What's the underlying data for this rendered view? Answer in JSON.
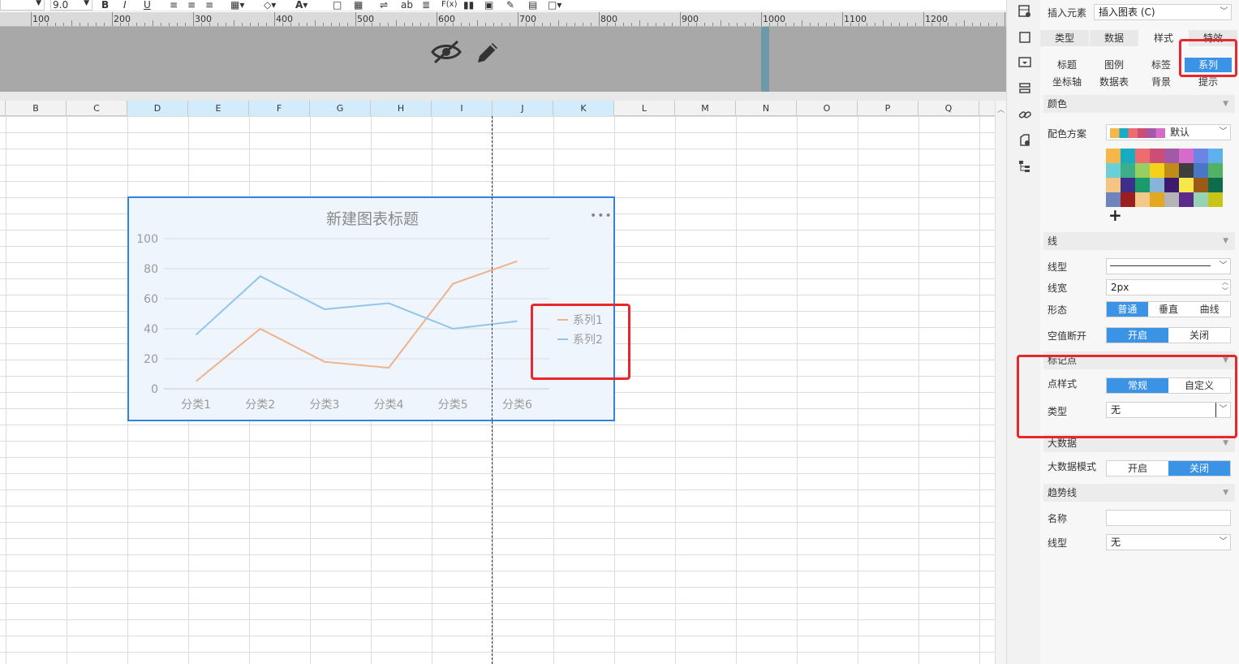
{
  "toolbar": {
    "font_size": "9.0",
    "bold": "B",
    "italic": "I",
    "underline": "U",
    "text_abc": "ab",
    "fx": "F(x)"
  },
  "ruler": {
    "labels": [
      "100",
      "200",
      "300",
      "400",
      "500",
      "600",
      "700",
      "800",
      "900",
      "1000",
      "1100",
      "1200"
    ]
  },
  "columns": [
    "B",
    "C",
    "D",
    "E",
    "F",
    "G",
    "H",
    "I",
    "J",
    "K",
    "L",
    "M",
    "N",
    "O",
    "P",
    "Q"
  ],
  "selected_columns": [
    "D",
    "E",
    "F",
    "G",
    "H",
    "I",
    "J",
    "K"
  ],
  "chart_data": {
    "type": "line",
    "title": "新建图表标题",
    "categories": [
      "分类1",
      "分类2",
      "分类3",
      "分类4",
      "分类5",
      "分类6"
    ],
    "series": [
      {
        "name": "系列1",
        "color": "#f0b28c",
        "values": [
          5,
          40,
          18,
          14,
          70,
          85
        ]
      },
      {
        "name": "系列2",
        "color": "#91c5ec",
        "values": [
          36,
          75,
          53,
          57,
          40,
          45
        ]
      }
    ],
    "ylim": [
      0,
      100
    ],
    "yticks": [
      "0",
      "20",
      "40",
      "60",
      "80",
      "100"
    ],
    "grid": true,
    "legend": "right",
    "menu": "•••"
  },
  "panel": {
    "insert_label": "插入元素",
    "insert_value": "插入图表 (C)",
    "tabs": [
      {
        "label": "类型",
        "active": false
      },
      {
        "label": "数据",
        "active": false
      },
      {
        "label": "样式",
        "active": true
      },
      {
        "label": "特效",
        "active": false
      }
    ],
    "subtabs_row1": [
      {
        "label": "标题",
        "active": false
      },
      {
        "label": "图例",
        "active": false
      },
      {
        "label": "标签",
        "active": false
      },
      {
        "label": "系列",
        "active": true
      }
    ],
    "subtabs_row2": [
      "坐标轴",
      "数据表",
      "背景",
      "提示"
    ],
    "color_section": "颜色",
    "scheme_label": "配色方案",
    "scheme_value": "默认",
    "palette": [
      "#f5b74a",
      "#1aabc4",
      "#ec6c70",
      "#cc4e74",
      "#a25aa8",
      "#d86bca",
      "#6c84e4",
      "#5fb1ec",
      "#6bd0d5",
      "#3dae88",
      "#96cf62",
      "#f4d21a",
      "#c08b1b",
      "#3e3e3e",
      "#4a76c8",
      "#52b264",
      "#f5c482",
      "#3c2f8a",
      "#1a9c6a",
      "#88b4d8",
      "#3c1a6e",
      "#f6e84a",
      "#9c5a16",
      "#0e6c4c",
      "#6e84be",
      "#9a1e1e",
      "#f4c888",
      "#e2a822",
      "#b4b4b4",
      "#5c2a8a",
      "#98d2b4",
      "#c8c418"
    ],
    "add": "+",
    "line_section": "线",
    "line_type_label": "线型",
    "line_width_label": "线宽",
    "line_width_value": "2px",
    "form_label": "形态",
    "form_options": [
      {
        "label": "普通",
        "active": true
      },
      {
        "label": "垂直",
        "active": false
      },
      {
        "label": "曲线",
        "active": false
      }
    ],
    "null_label": "空值断开",
    "null_options": [
      {
        "label": "开启",
        "active": true
      },
      {
        "label": "关闭",
        "active": false
      }
    ],
    "marker_section": "标记点",
    "point_style_label": "点样式",
    "point_style_options": [
      {
        "label": "常规",
        "active": true
      },
      {
        "label": "自定义",
        "active": false
      }
    ],
    "marker_type_label": "类型",
    "marker_type_value": "无",
    "bigdata_section": "大数据",
    "bigdata_label": "大数据模式",
    "bigdata_options": [
      {
        "label": "开启",
        "active": false
      },
      {
        "label": "关闭",
        "active": true
      }
    ],
    "trend_section": "趋势线",
    "trend_name_label": "名称",
    "trend_name_value": "",
    "trend_type_label": "线型",
    "trend_type_value": "无"
  }
}
